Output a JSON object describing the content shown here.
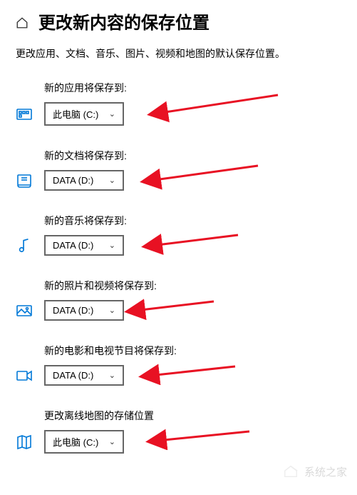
{
  "header": {
    "title": "更改新内容的保存位置"
  },
  "description": "更改应用、文档、音乐、图片、视频和地图的默认保存位置。",
  "colors": {
    "accent": "#0078D7",
    "arrow": "#E81123"
  },
  "settings": [
    {
      "label": "新的应用将保存到:",
      "value": "此电脑 (C:)",
      "icon": "apps"
    },
    {
      "label": "新的文档将保存到:",
      "value": "DATA (D:)",
      "icon": "documents"
    },
    {
      "label": "新的音乐将保存到:",
      "value": "DATA (D:)",
      "icon": "music"
    },
    {
      "label": "新的照片和视频将保存到:",
      "value": "DATA (D:)",
      "icon": "photos"
    },
    {
      "label": "新的电影和电视节目将保存到:",
      "value": "DATA (D:)",
      "icon": "movies"
    },
    {
      "label": "更改离线地图的存储位置",
      "value": "此电脑 (C:)",
      "icon": "maps"
    }
  ],
  "watermark": "系统之家"
}
